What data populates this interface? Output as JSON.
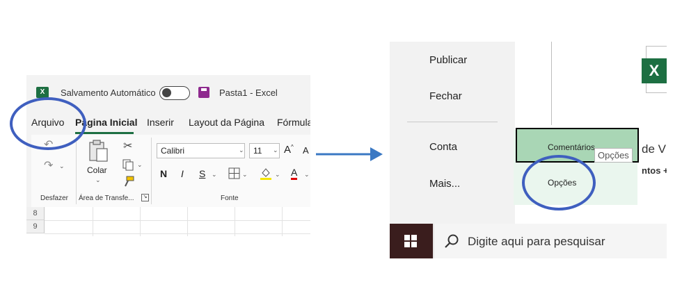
{
  "excel": {
    "app_icon": "X",
    "autosave_label": "Salvamento Automático",
    "doc_title": "Pasta1  -  Excel",
    "tabs": [
      "Arquivo",
      "Página Inicial",
      "Inserir",
      "Layout da Página",
      "Fórmula"
    ],
    "ribbon": {
      "undo_group_label": "Desfazer",
      "paste_label": "Colar",
      "clipboard_group_label": "Área de Transfe...",
      "font_name": "Calibri",
      "font_size": "11",
      "grow_font": "A",
      "shrink_font": "A",
      "bold": "N",
      "italic": "I",
      "underline": "S",
      "font_color_letter": "A",
      "font_group_label": "Fonte"
    },
    "rows": [
      "8",
      "9"
    ],
    "accent": "#1d6f42"
  },
  "backstage": {
    "menu_items": [
      "Publicar",
      "Fechar",
      "Conta",
      "Mais..."
    ],
    "app_icon": "X",
    "partial_text1": "de V",
    "partial_text2": "ntos +",
    "popup": {
      "selected_item": "Comentários",
      "item2": "Opções",
      "tooltip": "Opções"
    },
    "taskbar": {
      "search_placeholder": "Digite aqui para pesquisar"
    }
  },
  "annotation_color": "#3f5fbf",
  "icons": [
    "excel-icon",
    "save-icon",
    "undo-icon",
    "redo-icon",
    "paste-icon",
    "cut-icon",
    "copy-icon",
    "format-painter-icon",
    "borders-icon",
    "fill-color-icon",
    "arrow-icon",
    "windows-icon",
    "search-icon"
  ]
}
